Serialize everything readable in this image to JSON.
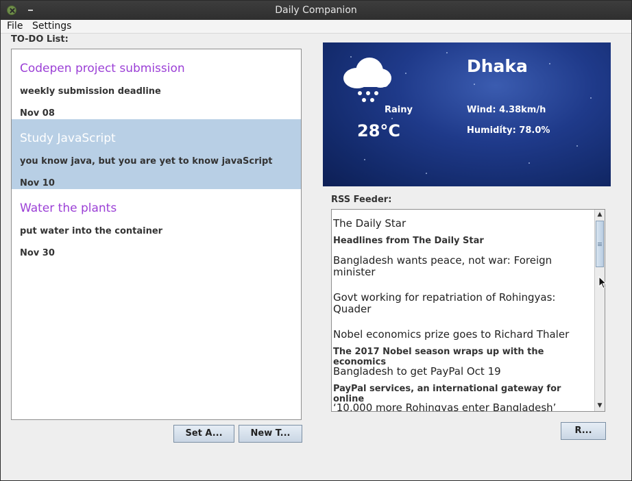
{
  "window": {
    "title": "Daily Companion"
  },
  "menu": {
    "items": [
      "File",
      "Settings"
    ]
  },
  "todo": {
    "label": "TO-DO List:",
    "items": [
      {
        "title": "Codepen project submission",
        "description": "weekly submission deadline",
        "date": "Nov 08",
        "selected": false
      },
      {
        "title": "Study JavaScript",
        "description": "you know java, but you are yet to know javaScript",
        "date": "Nov 10",
        "selected": true
      },
      {
        "title": "Water the plants",
        "description": "put water into the container",
        "date": "Nov 30",
        "selected": false
      }
    ],
    "buttons": {
      "set_alarm": "Set A...",
      "new_task": "New T..."
    }
  },
  "weather": {
    "city": "Dhaka",
    "condition": "Rainy",
    "temperature": "28°C",
    "wind": "Wind: 4.38km/h",
    "humidity": "Humidity: 78.0%",
    "icon": "snow-cloud-icon"
  },
  "rss": {
    "label": "RSS Feeder:",
    "lines": [
      {
        "text": "The Daily Star",
        "style": "h"
      },
      {
        "text": "Headlines from The Daily Star",
        "style": "s"
      },
      {
        "text": "Bangladesh wants peace, not war: Foreign",
        "style": "h"
      },
      {
        "text": "minister",
        "style": "h"
      },
      {
        "text": "Govt working for repatriation of Rohingyas:",
        "style": "h"
      },
      {
        "text": "Quader",
        "style": "h"
      },
      {
        "text": "Nobel economics prize goes to Richard Thaler",
        "style": "h"
      },
      {
        "text": "The 2017 Nobel season wraps up with the economics",
        "style": "s"
      },
      {
        "text": "Bangladesh to get PayPal Oct 19",
        "style": "h"
      },
      {
        "text": "PayPal services, an international gateway for online",
        "style": "s"
      },
      {
        "text": "‘10,000 more Rohingyas enter Bangladesh’",
        "style": "h"
      }
    ],
    "refresh_button": "R..."
  },
  "colors": {
    "todo_title": "#9b3fd6",
    "selection": "#b8cfe5",
    "weather_bg": "#1f3a8a"
  }
}
